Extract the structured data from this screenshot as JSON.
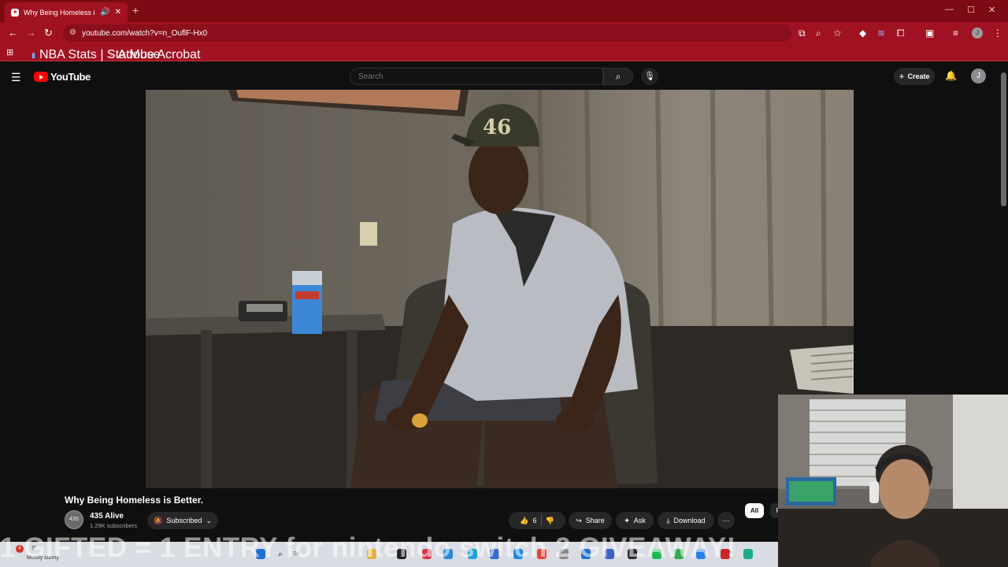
{
  "browser": {
    "tab_title": "Why Being Homeless is Better.",
    "address": "youtube.com/watch?v=n_OuflF-Hx0",
    "bookmarks": [
      "NBA Stats | StatMuse",
      "Adobe Acrobat"
    ],
    "profile_initial": "J",
    "theme_colors": {
      "tabstrip": "#7d0b14",
      "toolbar": "#a01221"
    }
  },
  "youtube": {
    "logo_text": "YouTube",
    "search_placeholder": "Search",
    "create_label": "Create",
    "avatar_initial": "J",
    "brand_color": "#ff0000"
  },
  "video": {
    "title": "Why Being Homeless is Better.",
    "channel": "435 Alive",
    "subscribers": "1.29K subscribers",
    "subscribed_label": "Subscribed",
    "likes": "6",
    "share_label": "Share",
    "ask_label": "Ask",
    "download_label": "Download",
    "chips": [
      "All",
      "F"
    ],
    "cap_text": "46"
  },
  "overlay": {
    "text": "1 GIFTED = 1 ENTRY for nintendo switch 2 GIVEAWAY!"
  },
  "taskbar": {
    "notification_count": "4",
    "temp": "7°",
    "weather": "Mostly sunny",
    "search_placeholder": "Se"
  }
}
